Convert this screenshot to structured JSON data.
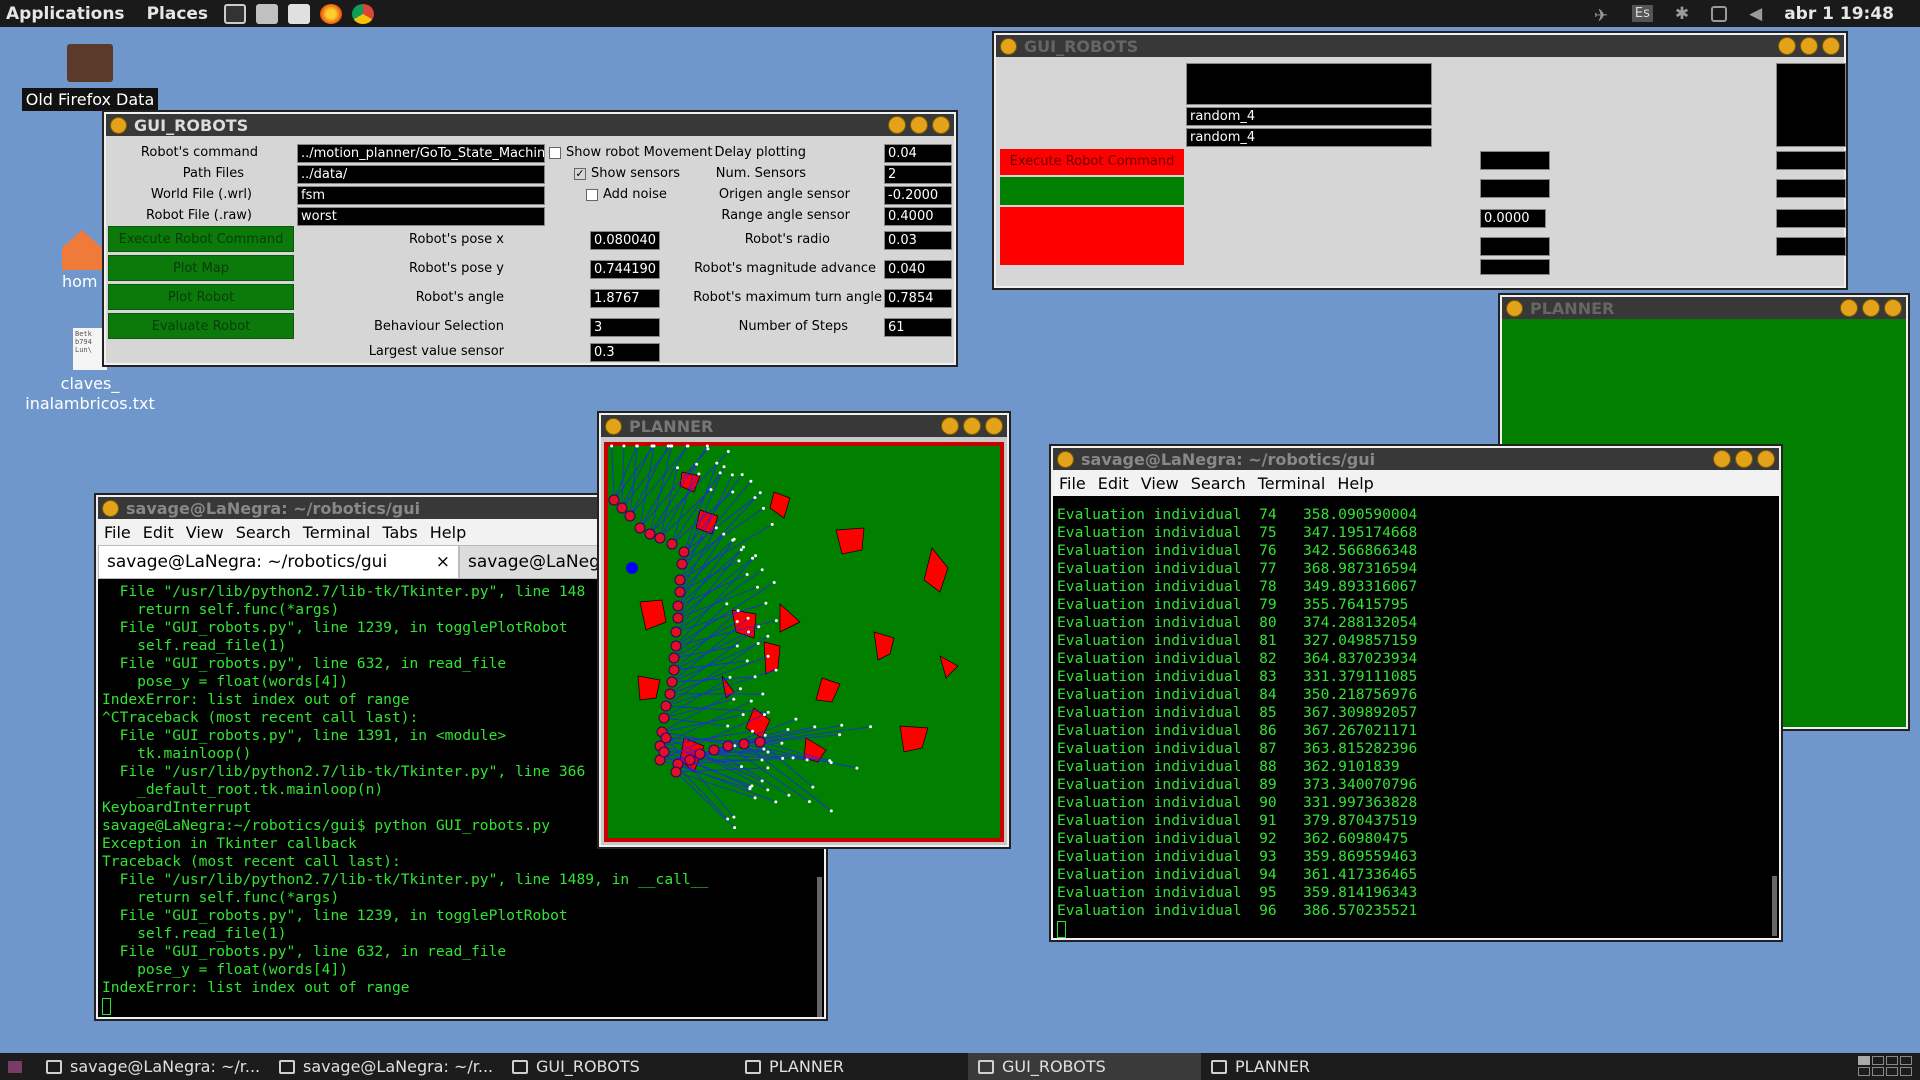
{
  "topbar": {
    "applications": "Applications",
    "places": "Places",
    "datetime": "abr 1 19:48",
    "lang": "Es"
  },
  "desktop": {
    "items": [
      {
        "label": "Old Firefox Data"
      },
      {
        "label": "hom"
      },
      {
        "label": "claves_\ninalambricos.txt"
      }
    ],
    "txt_preview": "Betk\nb794\nLun\\"
  },
  "gui_main": {
    "title": "GUI_ROBOTS",
    "labels": {
      "robots_command": "Robot's command",
      "path_files": "Path Files",
      "world_file": "World File (.wrl)",
      "robot_file": "Robot File (.raw)",
      "pose_x": "Robot's pose x",
      "pose_y": "Robot's pose y",
      "angle": "Robot's angle",
      "behaviour": "Behaviour Selection",
      "largest": "Largest value sensor",
      "delay": "Delay plotting",
      "num_sensors": "Num. Sensors",
      "origen": "Origen angle sensor",
      "range": "Range angle sensor",
      "radio": "Robot's radio",
      "magnitude": "Robot's magnitude advance",
      "max_turn": "Robot's maximum turn angle",
      "steps": "Number of Steps"
    },
    "values": {
      "robots_command": "../motion_planner/GoTo_State_Machine",
      "path_files": "../data/",
      "world_file": "fsm",
      "robot_file": "worst",
      "pose_x": "0.080040",
      "pose_y": "0.744190",
      "angle": "1.8767",
      "behaviour": "3",
      "largest": "0.3",
      "delay": "0.04",
      "num_sensors": "2",
      "origen": "-0.2000",
      "range": "0.4000",
      "radio": "0.03",
      "magnitude": "0.040",
      "max_turn": "0.7854",
      "steps": "61"
    },
    "checks": {
      "show_movement": "Show robot Movement",
      "show_sensors": "Show sensors",
      "add_noise": "Add noise",
      "sensors_mark": "✓"
    },
    "buttons": {
      "execute": "Execute Robot Command",
      "plot_map": "Plot Map",
      "plot_robot": "Plot Robot",
      "evaluate": "Evaluate Robot"
    }
  },
  "gui_second": {
    "title": "GUI_ROBOTS",
    "field1": "random_4",
    "field2": "random_4",
    "execute": "Execute Robot Command",
    "value": "0.0000"
  },
  "planner_main": {
    "title": "PLANNER"
  },
  "planner_second": {
    "title": "PLANNER"
  },
  "terminal_left": {
    "title": "savage@LaNegra: ~/robotics/gui",
    "menu": [
      "File",
      "Edit",
      "View",
      "Search",
      "Terminal",
      "Tabs",
      "Help"
    ],
    "tabs": [
      "savage@LaNegra: ~/robotics/gui",
      "savage@LaNegr"
    ],
    "tab_close": "×",
    "lines": [
      "  File \"/usr/lib/python2.7/lib-tk/Tkinter.py\", line 148",
      "    return self.func(*args)",
      "  File \"GUI_robots.py\", line 1239, in togglePlotRobot",
      "    self.read_file(1)",
      "  File \"GUI_robots.py\", line 632, in read_file",
      "    pose_y = float(words[4])",
      "IndexError: list index out of range",
      "^CTraceback (most recent call last):",
      "  File \"GUI_robots.py\", line 1391, in <module>",
      "    tk.mainloop()",
      "  File \"/usr/lib/python2.7/lib-tk/Tkinter.py\", line 366",
      "    _default_root.tk.mainloop(n)",
      "KeyboardInterrupt",
      "savage@LaNegra:~/robotics/gui$ python GUI_robots.py",
      "Exception in Tkinter callback",
      "Traceback (most recent call last):",
      "  File \"/usr/lib/python2.7/lib-tk/Tkinter.py\", line 1489, in __call__",
      "    return self.func(*args)",
      "  File \"GUI_robots.py\", line 1239, in togglePlotRobot",
      "    self.read_file(1)",
      "  File \"GUI_robots.py\", line 632, in read_file",
      "    pose_y = float(words[4])",
      "IndexError: list index out of range"
    ]
  },
  "terminal_right": {
    "title": "savage@LaNegra: ~/robotics/gui",
    "menu": [
      "File",
      "Edit",
      "View",
      "Search",
      "Terminal",
      "Help"
    ],
    "lines": [
      "Evaluation individual  74   358.090590004",
      "Evaluation individual  75   347.195174668",
      "Evaluation individual  76   342.566866348",
      "Evaluation individual  77   368.987316594",
      "Evaluation individual  78   349.893316067",
      "Evaluation individual  79   355.76415795",
      "Evaluation individual  80   374.288132054",
      "Evaluation individual  81   327.049857159",
      "Evaluation individual  82   364.837023934",
      "Evaluation individual  83   331.379111085",
      "Evaluation individual  84   350.218756976",
      "Evaluation individual  85   367.309892057",
      "Evaluation individual  86   367.267021171",
      "Evaluation individual  87   363.815282396",
      "Evaluation individual  88   362.9101839",
      "Evaluation individual  89   373.340070796",
      "Evaluation individual  90   331.997363828",
      "Evaluation individual  91   379.870437519",
      "Evaluation individual  92   362.60980475",
      "Evaluation individual  93   359.869559463",
      "Evaluation individual  94   361.417336465",
      "Evaluation individual  95   359.814196343",
      "Evaluation individual  96   386.570235521"
    ]
  },
  "taskbar": {
    "items": [
      {
        "label": "savage@LaNegra: ~/r..."
      },
      {
        "label": "savage@LaNegra: ~/r..."
      },
      {
        "label": "GUI_ROBOTS"
      },
      {
        "label": "PLANNER"
      },
      {
        "label": "GUI_ROBOTS",
        "active": true
      },
      {
        "label": "PLANNER"
      }
    ]
  },
  "colors": {
    "desktop": "#6f97cc",
    "planner_green": "#007f00",
    "obstacle_red": "#ff0000",
    "robot_blue": "#1010c8",
    "terminal_green": "#33e333"
  }
}
